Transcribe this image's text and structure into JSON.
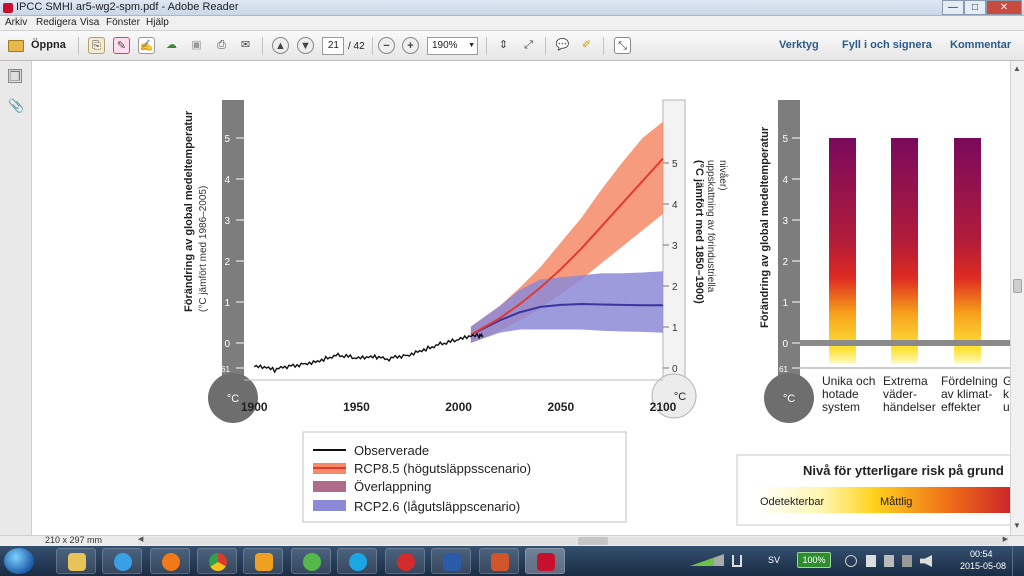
{
  "window": {
    "title": "IPCC SMHI ar5-wg2-spm.pdf - Adobe Reader",
    "minimize": "—",
    "maximize": "□",
    "close": "✕"
  },
  "menu": [
    "Arkiv",
    "Redigera",
    "Visa",
    "Fönster",
    "Hjälp"
  ],
  "toolbar": {
    "open_label": "Öppna",
    "page_current": "21",
    "page_total": "/ 42",
    "zoom": "190%",
    "tools": "Verktyg",
    "fill_sign": "Fyll i och signera",
    "comment": "Kommentar"
  },
  "icons": [
    "folder-open-icon",
    "create-pdf-icon",
    "edit-pdf-icon",
    "sign-icon",
    "cloud-upload-icon",
    "save-icon",
    "print-icon",
    "email-icon",
    "page-up-icon",
    "page-down-icon",
    "zoom-out-icon",
    "zoom-in-icon",
    "fit-page-icon",
    "fit-width-icon",
    "comment-icon",
    "highlight-icon",
    "fullscreen-icon",
    "pages-panel-icon",
    "attachments-icon"
  ],
  "status": {
    "page_size": "210 x 297 mm"
  },
  "chart_data": [
    {
      "type": "line",
      "y_left_title": "Förändring av global medeltemperatur",
      "y_left_sub": "(°C jämfört med 1986–2005)",
      "y_left_ticks": [
        "5",
        "4",
        "3",
        "2",
        "1",
        "0",
        "-0.61"
      ],
      "y_right_title": "(°C jämfört med 1850–1900)",
      "y_right_sub1": "uppskattning av förindustriella",
      "y_right_sub2": "nivåer)",
      "y_right_ticks": [
        "5",
        "4",
        "3",
        "2",
        "1",
        "0"
      ],
      "unit": "°C",
      "x_ticks": [
        "1900",
        "1950",
        "2000",
        "2050",
        "2100"
      ],
      "xlim": [
        1895,
        2100
      ],
      "ylim": [
        -0.61,
        5.5
      ],
      "series": [
        {
          "name": "Observerade",
          "color": "#111111",
          "x": [
            1900,
            1905,
            1910,
            1915,
            1920,
            1925,
            1930,
            1935,
            1940,
            1945,
            1950,
            1955,
            1960,
            1965,
            1970,
            1975,
            1980,
            1985,
            1990,
            1995,
            2000,
            2005,
            2010,
            2012
          ],
          "y": [
            -0.58,
            -0.6,
            -0.66,
            -0.58,
            -0.55,
            -0.5,
            -0.45,
            -0.38,
            -0.3,
            -0.32,
            -0.38,
            -0.36,
            -0.34,
            -0.4,
            -0.33,
            -0.3,
            -0.2,
            -0.13,
            -0.04,
            0.02,
            0.08,
            0.15,
            0.18,
            0.17
          ]
        },
        {
          "name": "RCP8.5 (högutsläppsscenario)",
          "color": "#e03a32",
          "band_color": "#f58a66",
          "x": [
            2006,
            2020,
            2030,
            2040,
            2050,
            2060,
            2070,
            2080,
            2090,
            2100
          ],
          "y": [
            0.2,
            0.6,
            0.95,
            1.35,
            1.8,
            2.3,
            2.85,
            3.4,
            3.95,
            4.5
          ],
          "low": [
            0.0,
            0.3,
            0.55,
            0.85,
            1.2,
            1.55,
            1.95,
            2.35,
            2.75,
            3.15
          ],
          "high": [
            0.4,
            0.9,
            1.35,
            1.85,
            2.45,
            3.05,
            3.75,
            4.4,
            5.0,
            5.4
          ]
        },
        {
          "name": "Överlappning",
          "color": "#b06a8a"
        },
        {
          "name": "RCP2.6 (lågutsläppscenario)",
          "color": "#3b35a0",
          "band_color": "#8c8ad6",
          "x": [
            2006,
            2020,
            2030,
            2040,
            2050,
            2060,
            2070,
            2080,
            2090,
            2100
          ],
          "y": [
            0.2,
            0.55,
            0.75,
            0.88,
            0.93,
            0.95,
            0.94,
            0.93,
            0.92,
            0.92
          ],
          "low": [
            0.0,
            0.25,
            0.33,
            0.33,
            0.33,
            0.33,
            0.3,
            0.28,
            0.27,
            0.25
          ],
          "high": [
            0.4,
            0.9,
            1.3,
            1.55,
            1.6,
            1.65,
            1.7,
            1.7,
            1.72,
            1.75
          ]
        }
      ]
    },
    {
      "type": "bar",
      "y_title": "Förändring av global medeltemperatur",
      "y_ticks": [
        "5",
        "4",
        "3",
        "2",
        "1",
        "0",
        "-0.61"
      ],
      "unit": "°C",
      "categories": [
        [
          "Unika och",
          "hotade",
          "system"
        ],
        [
          "Extrema",
          "väder-",
          "händelser"
        ],
        [
          "Fördelning",
          "av klimat-",
          "effekter"
        ],
        [
          "G",
          "k",
          "u"
        ]
      ],
      "values": [
        5,
        5,
        5
      ],
      "ylim": [
        -0.61,
        5.5
      ]
    }
  ],
  "legend": {
    "items": [
      "Observerade",
      "RCP8.5 (högutsläppsscenario)",
      "Överlappning",
      "RCP2.6 (lågutsläppscenario)"
    ]
  },
  "risk_legend": {
    "title": "Nivå för ytterligare risk på grund",
    "low": "Odetekterbar",
    "mid": "Måttlig"
  },
  "taskbar": {
    "time": "00:54",
    "date": "2015-05-08",
    "battery": "100%",
    "lang": "SV"
  }
}
